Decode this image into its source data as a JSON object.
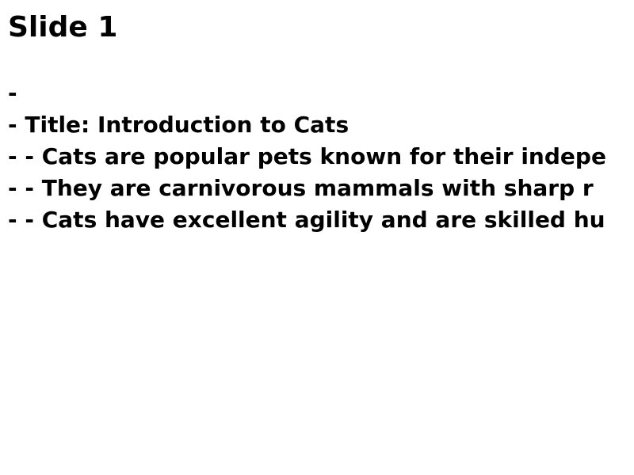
{
  "slide": {
    "title": "Slide 1",
    "lines": [
      "-",
      "- Title: Introduction to Cats",
      "- - Cats are popular pets known for their indepe",
      "- - They are carnivorous mammals with sharp r",
      "- - Cats have excellent agility and are skilled hu"
    ]
  },
  "colors": {
    "background": "#ffffff",
    "text": "#000000"
  }
}
